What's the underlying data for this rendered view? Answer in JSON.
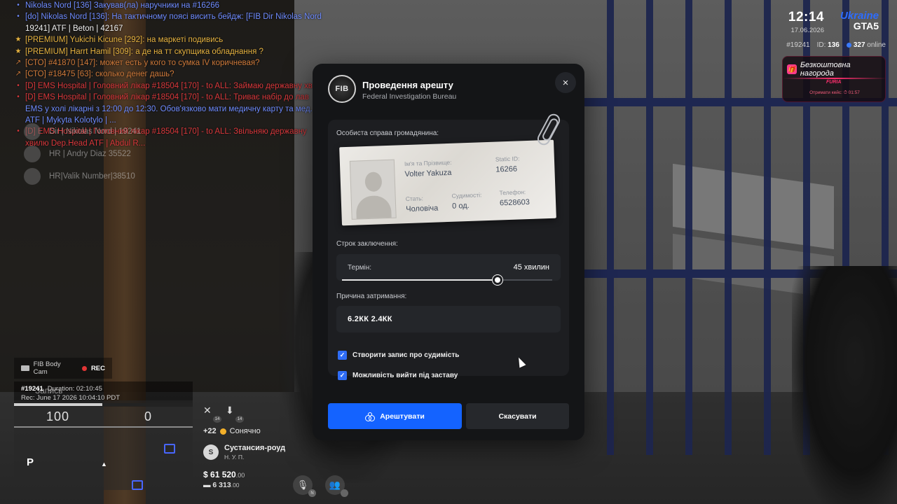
{
  "chat": {
    "lines": [
      {
        "mark": "•",
        "color": "c-blue",
        "text": "Nikolas Nord [136] Закував(ла) наручники на #16266"
      },
      {
        "mark": "•",
        "color": "c-blue",
        "text": "[do] Nikolas Nord [136]: На тактичному поясі висить бейдж: [FIB Dir Nikolas Nord"
      },
      {
        "mark": "",
        "color": "c-white",
        "text": "19241]    ATF | Beton | 42167"
      },
      {
        "mark": "★",
        "color": "c-gold",
        "text": "[PREMIUM] Yukichi Kicune [292]: на маркеті подивись"
      },
      {
        "mark": "★",
        "color": "c-gold",
        "text": "[PREMIUM] Harrt Hamil [309]: а де на тт скупщика обладнання ?"
      },
      {
        "mark": "↗",
        "color": "c-orange",
        "text": "[СТО] #41870 [147]: может есть у кого то сумка IV коричневая?"
      },
      {
        "mark": "↗",
        "color": "c-orange",
        "text": "[СТО] #18475 [63]: сколько денег дашь?"
      },
      {
        "mark": "•",
        "color": "c-red",
        "text": "[D] EMS Hospital | Головний лікар #18504 [170] - to ALL: Займаю державну хвилю"
      },
      {
        "mark": "•",
        "color": "c-red",
        "text": "[D] EMS Hospital | Головний лікар #18504 [170] - to ALL: Триває набір до лав"
      },
      {
        "mark": "",
        "color": "c-blue",
        "text": "EMS у холі лікарні з 12:00 до 12:30. Обов'язково мати медичну карту та мед. книжку"
      },
      {
        "mark": "",
        "color": "c-blue",
        "text": "ATF | Mykyta Kolotylo | ..."
      },
      {
        "mark": "•",
        "color": "c-red",
        "text": "[D] EMS Hospital | Головний лікар #18504 [170] - to ALL: Звільняю державну"
      },
      {
        "mark": "",
        "color": "c-red",
        "text": "хвилю    Dep.Head ATF | Abdul R..."
      }
    ],
    "names": [
      "Dir | Nikolas Nord | 19241",
      "HR | Andry Diaz 35522",
      "HR|Valik Number|38510"
    ]
  },
  "hud": {
    "time": "12:14",
    "date": "17.06.2026",
    "logo_top": "Ukraine",
    "logo_bottom": "GTA5",
    "player_tag": "#19241",
    "id_label": "ID:",
    "id_value": "136",
    "online_value": "327",
    "online_label": "online",
    "reward_title": "Безкоштовна нагорода",
    "reward_brand": "FURIA",
    "reward_sub": "Отримати кейс: ⏱ 01:57"
  },
  "bodycam": {
    "label": "FIB Body Cam",
    "rec": "REC",
    "id": "#19241",
    "duration": "Duration: 02:10:45",
    "rec_time": "Rec: June 17 2026 10:04:10 PDT",
    "ghost": "Запись",
    "value_left": "100",
    "value_right": "0",
    "marker": "P"
  },
  "status": {
    "need1_level": "14",
    "need2_level": "14",
    "temp": "+22",
    "weather": "Сонячно",
    "street_letter": "S",
    "street": "Сустансия-роуд",
    "area": "Н. У. П.",
    "cash": "61 520",
    "cash_cents": ".00",
    "bank": "6 313",
    "bank_cents": ".00",
    "mic_key": "N"
  },
  "modal": {
    "badge": "FIB",
    "title": "Проведення арешту",
    "subtitle": "Federal Investigation Bureau",
    "close": "×",
    "case_label": "Особиста справа громадянина:",
    "card": {
      "name_label": "Ім'я та Прізвище:",
      "name_value": "Volter Yakuza",
      "static_label": "Static ID:",
      "static_value": "16266",
      "sex_label": "Стать:",
      "sex_value": "Чоловіча",
      "convictions_label": "Судимості:",
      "convictions_value": "0 од.",
      "phone_label": "Телефон:",
      "phone_value": "6528603"
    },
    "term_section": "Строк заключення:",
    "term_label": "Термін:",
    "term_value": "45 хвилин",
    "term_fraction": 0.74,
    "reason_section": "Причина затримання:",
    "reason_value": "6.2КК 2.4КК",
    "check1": "Створити запис про судимість",
    "check2": "Можливість вийти під заставу",
    "arrest_button": "Арештувати",
    "cancel_button": "Скасувати"
  }
}
